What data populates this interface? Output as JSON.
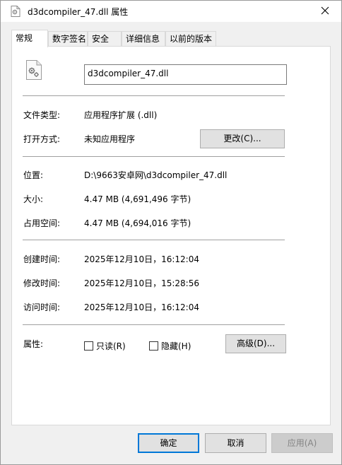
{
  "window": {
    "title": "d3dcompiler_47.dll 属性",
    "close_glyph": "✕"
  },
  "tabs": [
    {
      "label": "常规",
      "active": true
    },
    {
      "label": "数字签名",
      "active": false
    },
    {
      "label": "安全",
      "active": false
    },
    {
      "label": "详细信息",
      "active": false
    },
    {
      "label": "以前的版本",
      "active": false
    }
  ],
  "general": {
    "file_name": "d3dcompiler_47.dll",
    "file_type_label": "文件类型:",
    "file_type_value": "应用程序扩展 (.dll)",
    "opens_with_label": "打开方式:",
    "opens_with_value": "未知应用程序",
    "change_button": "更改(C)...",
    "location_label": "位置:",
    "location_value": "D:\\9663安卓网\\d3dcompiler_47.dll",
    "size_label": "大小:",
    "size_value": "4.47 MB (4,691,496 字节)",
    "size_on_disk_label": "占用空间:",
    "size_on_disk_value": "4.47 MB (4,694,016 字节)",
    "created_label": "创建时间:",
    "created_value": "2025年12月10日，16:12:04",
    "modified_label": "修改时间:",
    "modified_value": "2025年12月10日，15:28:56",
    "accessed_label": "访问时间:",
    "accessed_value": "2025年12月10日，16:12:04",
    "attributes_label": "属性:",
    "readonly_label": "只读(R)",
    "readonly_checked": false,
    "hidden_label": "隐藏(H)",
    "hidden_checked": false,
    "advanced_button": "高级(D)..."
  },
  "footer": {
    "ok_button": "确定",
    "cancel_button": "取消",
    "apply_button": "应用(A)",
    "apply_enabled": false
  },
  "colors": {
    "accent": "#0078d7",
    "panel_bg": "#ffffff",
    "window_bg": "#f0f0f0"
  },
  "icons": {
    "title": "dll-file-icon",
    "file": "dll-gear-file-icon",
    "close": "close-icon"
  }
}
